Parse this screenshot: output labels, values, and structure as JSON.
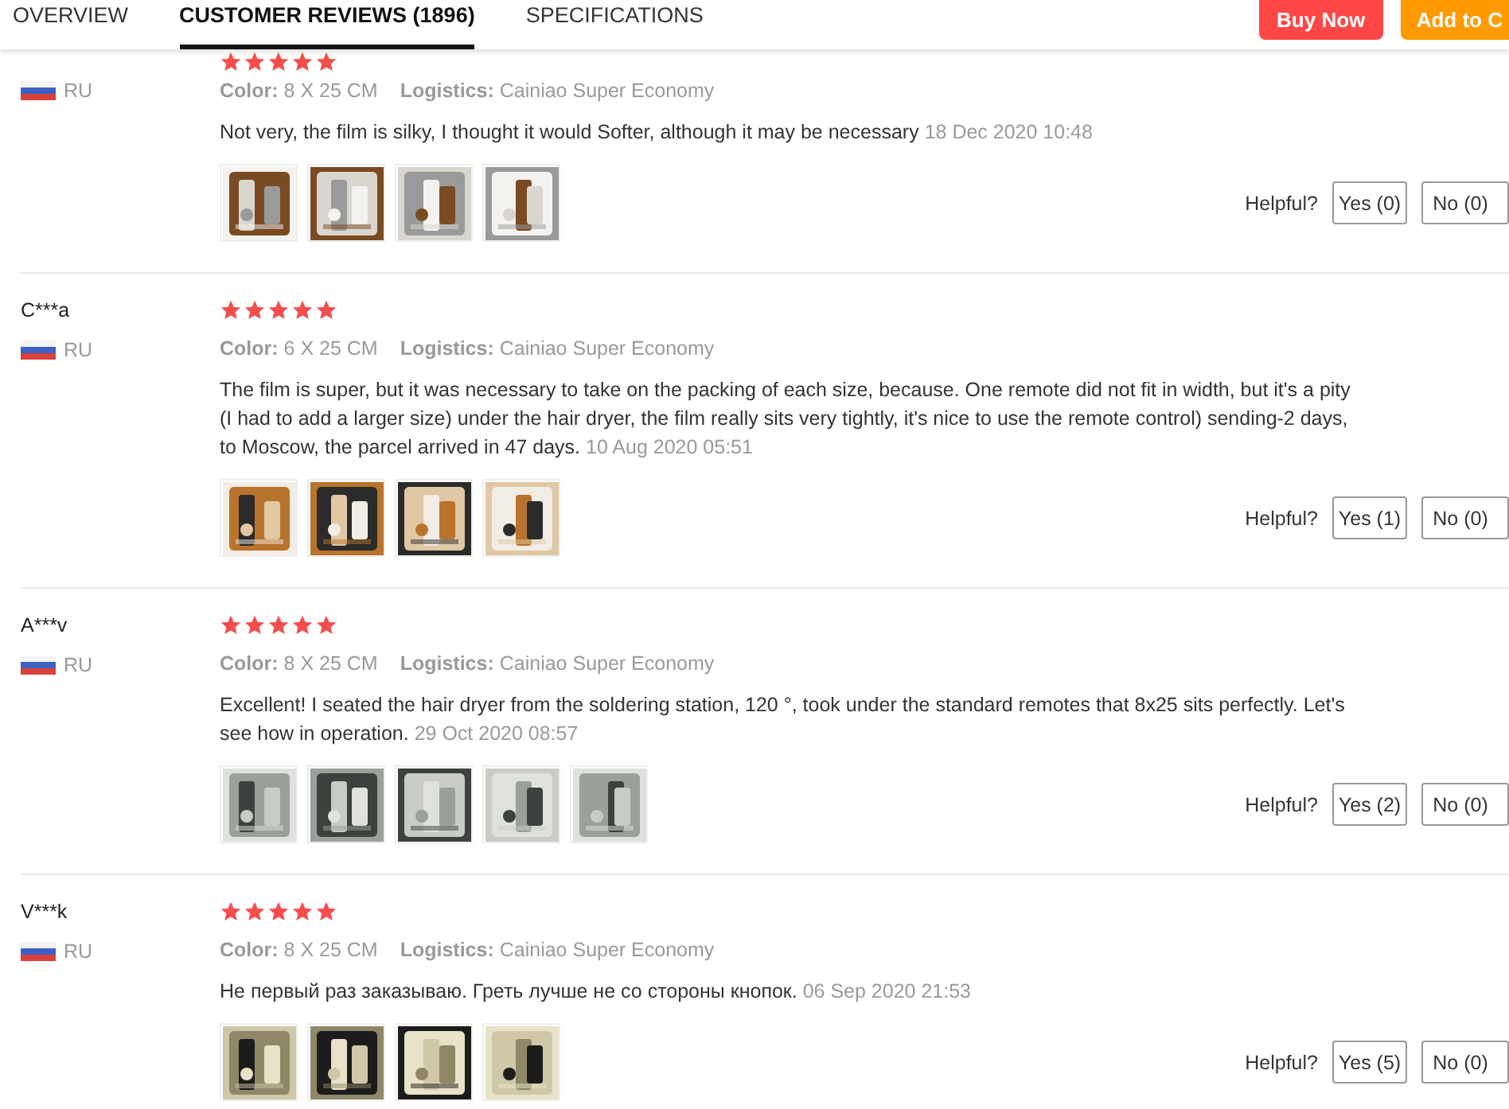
{
  "tabs": [
    {
      "label": "OVERVIEW",
      "selected": false
    },
    {
      "label": "CUSTOMER REVIEWS (1896)",
      "selected": true
    },
    {
      "label": "SPECIFICATIONS",
      "selected": false
    }
  ],
  "actions": [
    {
      "label": "Buy Now",
      "kind": "buy"
    },
    {
      "label": "Add to C",
      "kind": "cart"
    }
  ],
  "reviews": [
    {
      "country": "RU",
      "stars": 5,
      "color_label": "Color:",
      "variant": "8 X 25 CM",
      "logistics_label": "Logistics:",
      "logistics": "Cainiao Super Economy",
      "text": "Not very, the film is silky, I thought it would Softer, although it may be necessary",
      "date": "18 Dec 2020 10:48",
      "images": [
        {
          "kind": "picture"
        },
        {
          "kind": "picture"
        },
        {
          "kind": "picture"
        },
        {
          "kind": "picture"
        }
      ],
      "helpful_label": "Helpful?",
      "yes": "Yes (0)",
      "no": "No (0)"
    },
    {
      "name": "C***a",
      "country": "RU",
      "stars": 5,
      "color_label": "Color:",
      "variant": "6 X 25 CM",
      "logistics_label": "Logistics:",
      "logistics": "Cainiao Super Economy",
      "text": "The film is super, but it was necessary to take on the packing of each size, because. One remote did not fit in width, but it's a pity (I had to add a larger size) under the hair dryer, the film really sits very tightly, it's nice to use the remote control) sending-2 days, to Moscow, the parcel arrived in 47 days.",
      "date": "10 Aug 2020 05:51",
      "images": [
        {
          "kind": "picture"
        },
        {
          "kind": "picture"
        },
        {
          "kind": "picture"
        },
        {
          "kind": "picture"
        }
      ],
      "helpful_label": "Helpful?",
      "yes": "Yes (1)",
      "no": "No (0)"
    },
    {
      "name": "A***v",
      "country": "RU",
      "stars": 5,
      "color_label": "Color:",
      "variant": "8 X 25 CM",
      "logistics_label": "Logistics:",
      "logistics": "Cainiao Super Economy",
      "text": "Excellent! I seated the hair dryer from the soldering station, 120 °, took under the standard remotes that 8x25 sits perfectly. Let's see how in operation.",
      "date": "29 Oct 2020 08:57",
      "images": [
        {
          "kind": "picture"
        },
        {
          "kind": "picture"
        },
        {
          "kind": "picture"
        },
        {
          "kind": "picture"
        },
        {
          "kind": "picture"
        }
      ],
      "helpful_label": "Helpful?",
      "yes": "Yes (2)",
      "no": "No (0)"
    },
    {
      "name": "V***k",
      "country": "RU",
      "stars": 5,
      "color_label": "Color:",
      "variant": "8 X 25 CM",
      "logistics_label": "Logistics:",
      "logistics": "Cainiao Super Economy",
      "text": "Не первый раз заказываю. Греть лучше не со стороны кнопок.",
      "date": "06 Sep 2020 21:53",
      "images": [
        {
          "kind": "picture"
        },
        {
          "kind": "picture"
        },
        {
          "kind": "picture"
        },
        {
          "kind": "picture"
        }
      ],
      "helpful_label": "Helpful?",
      "yes": "Yes (5)",
      "no": "No (0)"
    }
  ]
}
